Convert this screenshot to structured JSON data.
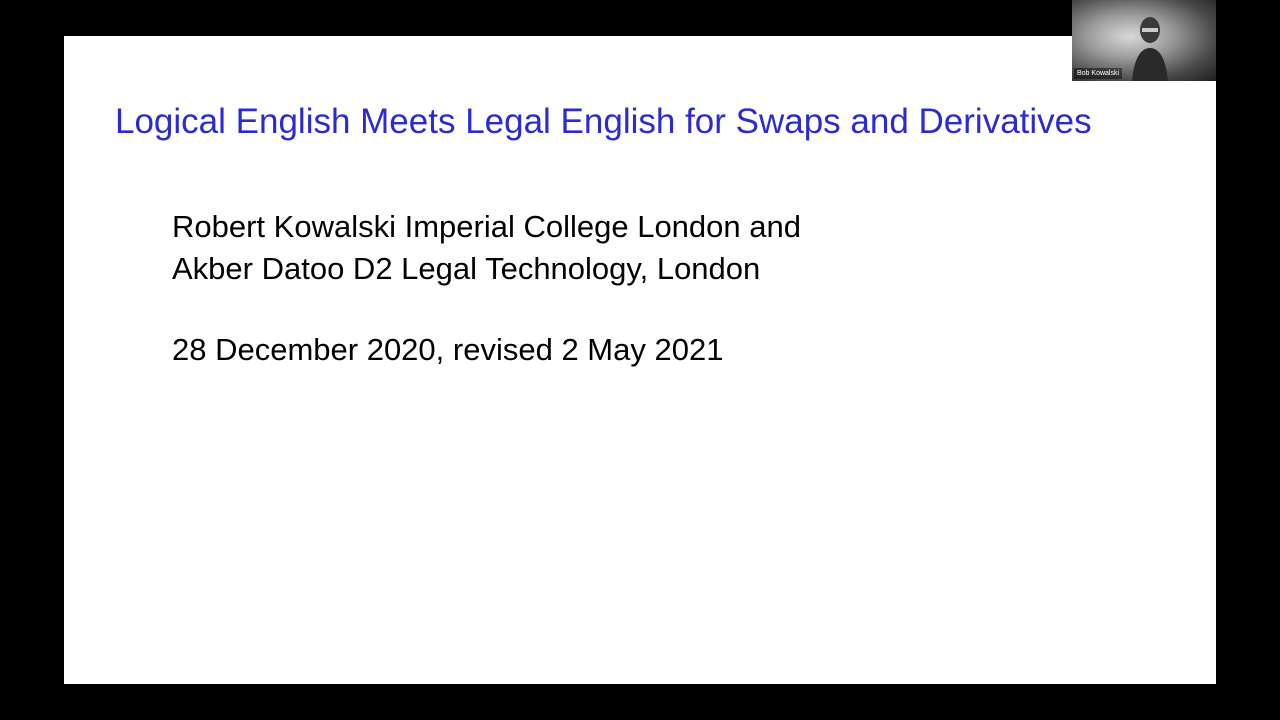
{
  "slide": {
    "title": "Logical English Meets Legal English for Swaps and Derivatives",
    "authors": [
      "Robert Kowalski Imperial College London and",
      "Akber Datoo D2 Legal Technology, London"
    ],
    "date": "28 December 2020, revised 2 May 2021",
    "colors": {
      "title": "#2b2bd6",
      "body": "#000000",
      "background": "#ffffff"
    }
  },
  "video": {
    "participant_name": "Bob Kowalski"
  }
}
